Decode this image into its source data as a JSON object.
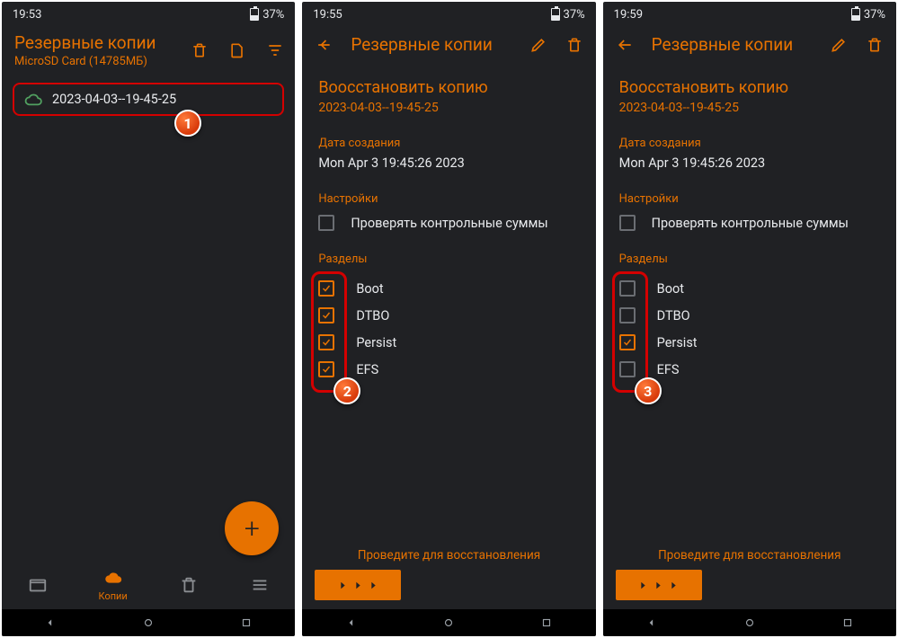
{
  "screen1": {
    "time": "19:53",
    "battery": "37%",
    "title": "Резервные копии",
    "subtitle": "MicroSD Card (14785МБ)",
    "backup_name": "2023-04-03--19-45-25",
    "nav_copies": "Копии",
    "callout": "1"
  },
  "screen2": {
    "time": "19:55",
    "battery": "37%",
    "header_title": "Резервные копии",
    "restore_title": "Воосстановить копию",
    "restore_sub": "2023-04-03--19-45-25",
    "created_label": "Дата создания",
    "created_value": "Mon Apr  3 19:45:26 2023",
    "settings_label": "Настройки",
    "checksum_label": "Проверять контрольные суммы",
    "partitions_label": "Разделы",
    "partitions": [
      {
        "label": "Boot",
        "checked": true
      },
      {
        "label": "DTBO",
        "checked": true
      },
      {
        "label": "Persist",
        "checked": true
      },
      {
        "label": "EFS",
        "checked": true
      }
    ],
    "swipe_label": "Проведите для восстановления",
    "callout": "2"
  },
  "screen3": {
    "time": "19:59",
    "battery": "37%",
    "header_title": "Резервные копии",
    "restore_title": "Воосстановить копию",
    "restore_sub": "2023-04-03--19-45-25",
    "created_label": "Дата создания",
    "created_value": "Mon Apr  3 19:45:26 2023",
    "settings_label": "Настройки",
    "checksum_label": "Проверять контрольные суммы",
    "partitions_label": "Разделы",
    "partitions": [
      {
        "label": "Boot",
        "checked": false
      },
      {
        "label": "DTBO",
        "checked": false
      },
      {
        "label": "Persist",
        "checked": true
      },
      {
        "label": "EFS",
        "checked": false
      }
    ],
    "swipe_label": "Проведите для восстановления",
    "callout": "3"
  }
}
